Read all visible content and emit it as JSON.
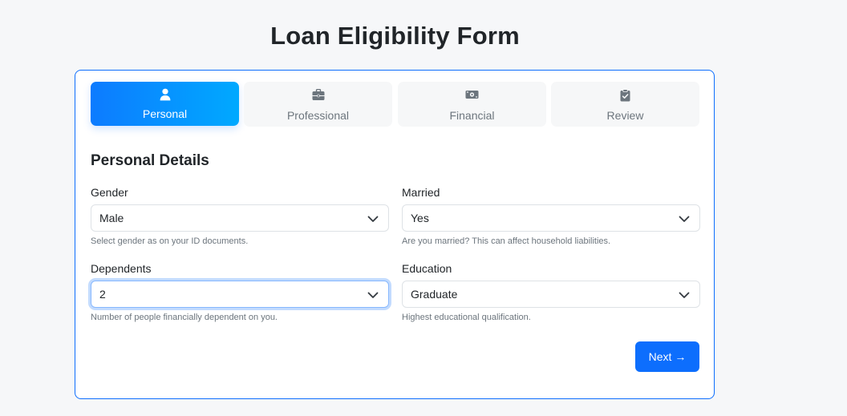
{
  "page": {
    "title": "Loan Eligibility Form"
  },
  "steps": [
    {
      "label": "Personal",
      "icon": "user-icon",
      "active": true
    },
    {
      "label": "Professional",
      "icon": "briefcase-icon",
      "active": false
    },
    {
      "label": "Financial",
      "icon": "money-bill-icon",
      "active": false
    },
    {
      "label": "Review",
      "icon": "clipboard-check-icon",
      "active": false
    }
  ],
  "section": {
    "title": "Personal Details"
  },
  "fields": {
    "gender": {
      "label": "Gender",
      "value": "Male",
      "help": "Select gender as on your ID documents."
    },
    "married": {
      "label": "Married",
      "value": "Yes",
      "help": "Are you married? This can affect household liabilities."
    },
    "dependents": {
      "label": "Dependents",
      "value": "2",
      "help": "Number of people financially dependent on you."
    },
    "education": {
      "label": "Education",
      "value": "Graduate",
      "help": "Highest educational qualification."
    }
  },
  "actions": {
    "next_label": "Next →"
  },
  "colors": {
    "primary": "#0d6efd",
    "active_step_gradient_start": "#0d7bff",
    "active_step_gradient_end": "#00a9ff",
    "inactive_step_bg": "#f6f7f8",
    "muted_text": "#6c757d"
  }
}
